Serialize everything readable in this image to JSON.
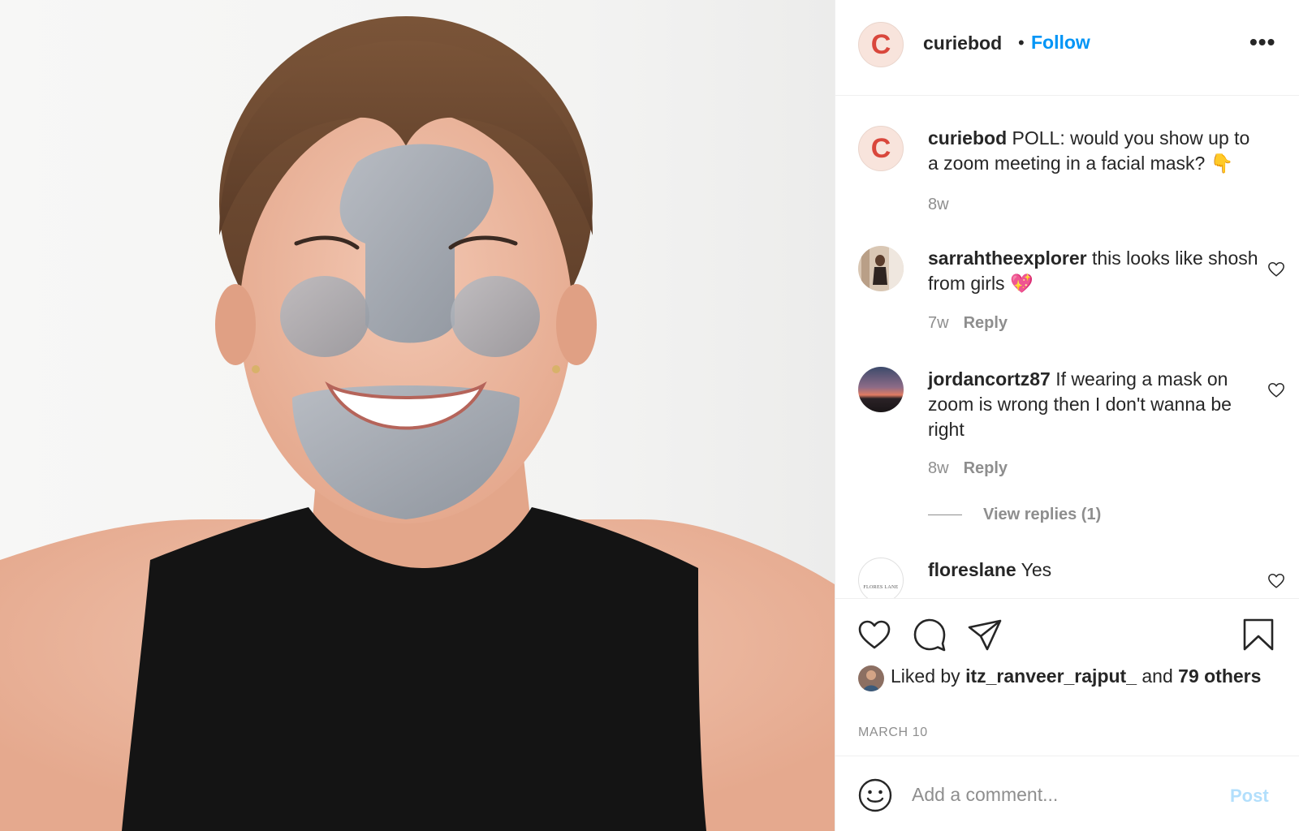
{
  "post_image": {
    "alt": "Woman smiling wearing a grey clay facial mask"
  },
  "header": {
    "username": "curiebod",
    "separator": "•",
    "follow_label": "Follow",
    "more_label": "•••",
    "avatar_letter": "C"
  },
  "caption": {
    "username": "curiebod",
    "text": " POLL: would you show up to a zoom meeting in a facial mask? 👇",
    "time": "8w",
    "avatar_letter": "C"
  },
  "comments": [
    {
      "username": "sarrahtheexplorer",
      "text": " this looks like shosh from girls 💖",
      "time": "7w",
      "reply_label": "Reply"
    },
    {
      "username": "jordancortz87",
      "text": " If wearing a mask on zoom is wrong then I don't wanna be right",
      "time": "8w",
      "reply_label": "Reply",
      "view_replies": "View replies (1)"
    },
    {
      "username": "floreslane",
      "text": " Yes",
      "avatar_text": "FLORES LANE"
    }
  ],
  "likes": {
    "prefix": "Liked by ",
    "liker": "itz_ranveer_rajput_",
    "middle": " and ",
    "others": "79 others"
  },
  "date": "MARCH 10",
  "add_comment": {
    "placeholder": "Add a comment...",
    "post_label": "Post"
  },
  "colors": {
    "link_blue": "#0095f6",
    "post_disabled": "#b2dffc",
    "secondary_text": "#8e8e8e",
    "brand_avatar_bg": "#f8e4dc",
    "brand_letter": "#d9473c"
  }
}
